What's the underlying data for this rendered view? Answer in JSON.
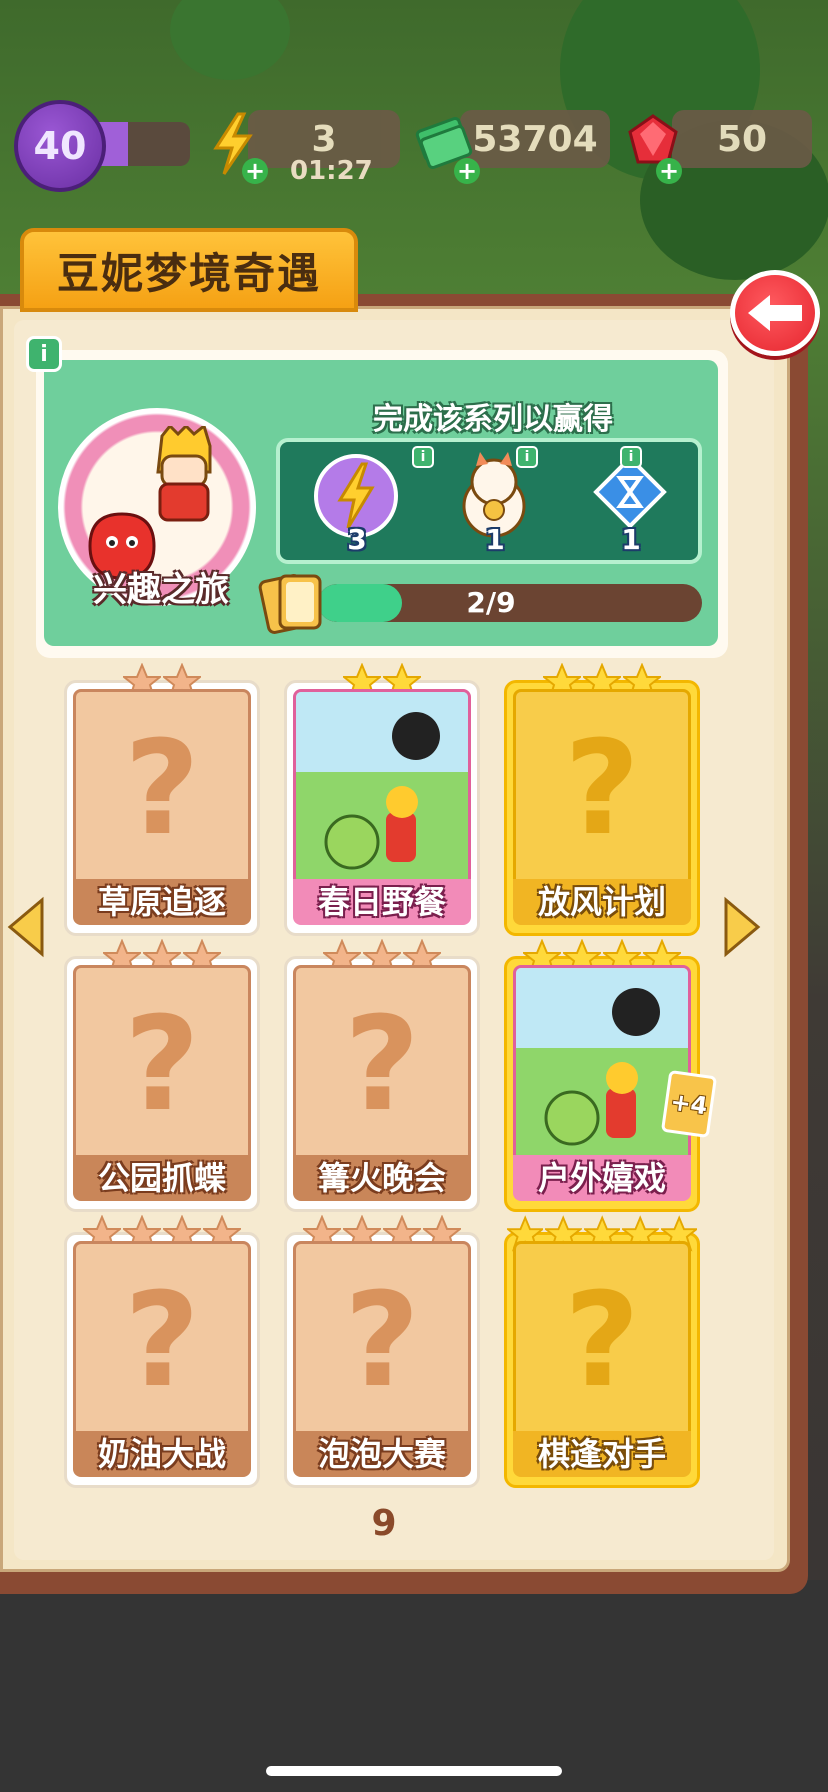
{
  "hud": {
    "level": "40",
    "energy": "3",
    "energy_timer": "01:27",
    "cash": "53704",
    "gems": "50"
  },
  "title": "豆妮梦境奇遇",
  "rewards": {
    "heading": "完成该系列以赢得",
    "collection_name": "兴趣之旅",
    "items": [
      {
        "name": "lightning-orb-icon",
        "count": "3"
      },
      {
        "name": "lucky-cat-icon",
        "count": "1"
      },
      {
        "name": "hourglass-gem-icon",
        "count": "1"
      }
    ],
    "progress_text": "2/9",
    "progress_value": 0.22
  },
  "cards": [
    {
      "label": "草原追逐",
      "stars": 2,
      "state": "locked"
    },
    {
      "label": "春日野餐",
      "stars": 2,
      "state": "owned"
    },
    {
      "label": "放风计划",
      "stars": 3,
      "state": "gold-locked"
    },
    {
      "label": "公园抓蝶",
      "stars": 3,
      "state": "locked"
    },
    {
      "label": "篝火晚会",
      "stars": 3,
      "state": "locked"
    },
    {
      "label": "户外嬉戏",
      "stars": 4,
      "state": "owned-gold",
      "extra": "+4"
    },
    {
      "label": "奶油大战",
      "stars": 4,
      "state": "locked"
    },
    {
      "label": "泡泡大赛",
      "stars": 4,
      "state": "locked"
    },
    {
      "label": "棋逢对手",
      "stars": 5,
      "state": "gold-locked"
    }
  ],
  "page_number": "9",
  "colors": {
    "panel": "#f4e6c6",
    "reward_green": "#6fcf9c",
    "title_tab": "#ffc33a",
    "back_button": "#e5252e"
  }
}
